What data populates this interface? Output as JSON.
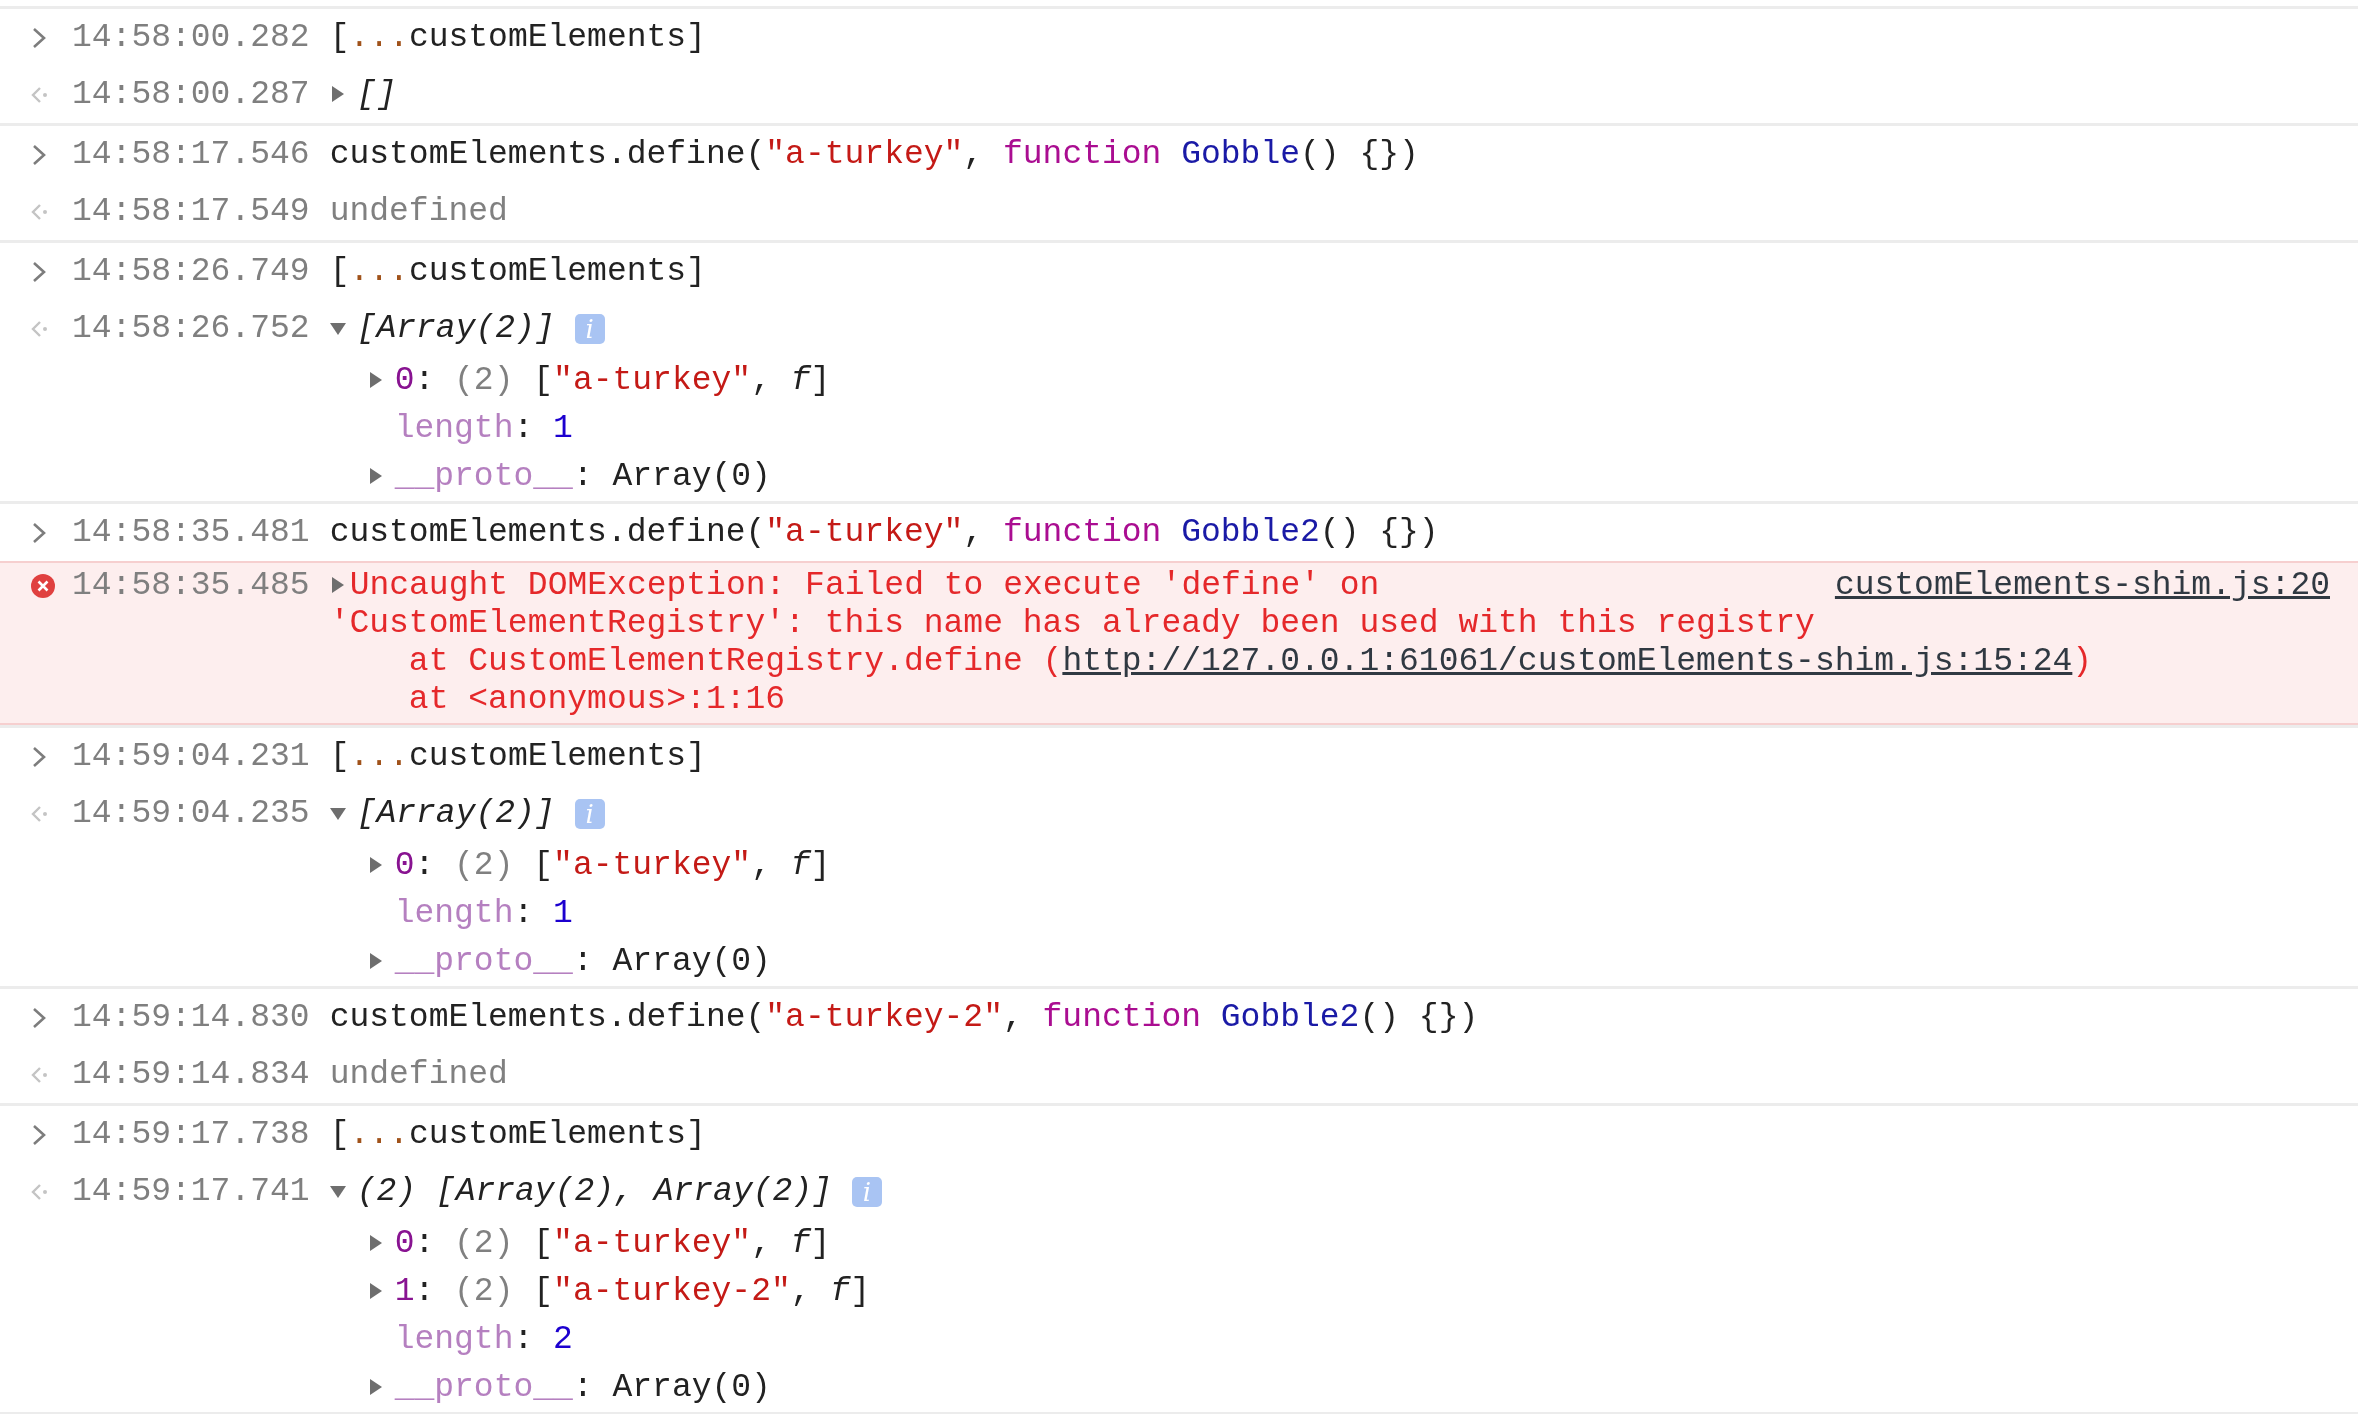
{
  "entries": [
    {
      "messages": [
        {
          "kind": "input",
          "time": "14:58:00.282",
          "tokens": [
            {
              "kind": "plain",
              "text": "["
            },
            {
              "kind": "spread",
              "text": "..."
            },
            {
              "kind": "plain",
              "text": "customElements]"
            }
          ]
        },
        {
          "kind": "output",
          "time": "14:58:00.287",
          "expanded": false,
          "tokens": [
            {
              "kind": "italic",
              "text": "[]"
            }
          ]
        }
      ]
    },
    {
      "messages": [
        {
          "kind": "input",
          "time": "14:58:17.546",
          "tokens": [
            {
              "kind": "plain",
              "text": "customElements.define("
            },
            {
              "kind": "string",
              "text": "\"a-turkey\""
            },
            {
              "kind": "plain",
              "text": ", "
            },
            {
              "kind": "keyword",
              "text": "function"
            },
            {
              "kind": "funcname",
              "text": " Gobble"
            },
            {
              "kind": "plain",
              "text": "() {})"
            }
          ]
        },
        {
          "kind": "output",
          "time": "14:58:17.549",
          "tokens": [
            {
              "kind": "muted",
              "text": "undefined"
            }
          ]
        }
      ]
    },
    {
      "messages": [
        {
          "kind": "input",
          "time": "14:58:26.749",
          "tokens": [
            {
              "kind": "plain",
              "text": "["
            },
            {
              "kind": "spread",
              "text": "..."
            },
            {
              "kind": "plain",
              "text": "customElements]"
            }
          ]
        },
        {
          "kind": "output",
          "time": "14:58:26.752",
          "expanded": true,
          "badge": "i",
          "tokens": [
            {
              "kind": "italic",
              "text": "[Array(2)]"
            }
          ],
          "children": [
            {
              "expanded": false,
              "tokens": [
                {
                  "kind": "index",
                  "text": "0"
                },
                {
                  "kind": "plain",
                  "text": ": "
                },
                {
                  "kind": "muted",
                  "text": "(2)"
                },
                {
                  "kind": "plain",
                  "text": " ["
                },
                {
                  "kind": "string",
                  "text": "\"a-turkey\""
                },
                {
                  "kind": "plain",
                  "text": ", "
                },
                {
                  "kind": "italic",
                  "text": "f"
                },
                {
                  "kind": "plain",
                  "text": "]"
                }
              ]
            },
            {
              "tokens": [
                {
                  "kind": "nonenum",
                  "text": "length"
                },
                {
                  "kind": "plain",
                  "text": ": "
                },
                {
                  "kind": "number",
                  "text": "1"
                }
              ]
            },
            {
              "expanded": false,
              "tokens": [
                {
                  "kind": "nonenum",
                  "text": "__proto__"
                },
                {
                  "kind": "plain",
                  "text": ": Array(0)"
                }
              ]
            }
          ]
        }
      ]
    },
    {
      "messages": [
        {
          "kind": "input",
          "time": "14:58:35.481",
          "tokens": [
            {
              "kind": "plain",
              "text": "customElements.define("
            },
            {
              "kind": "string",
              "text": "\"a-turkey\""
            },
            {
              "kind": "plain",
              "text": ", "
            },
            {
              "kind": "keyword",
              "text": "function"
            },
            {
              "kind": "funcname",
              "text": " Gobble2"
            },
            {
              "kind": "plain",
              "text": "() {})"
            }
          ]
        },
        {
          "kind": "error",
          "time": "14:58:35.485",
          "expanded": false,
          "source": "customElements-shim.js:20",
          "lines": [
            [
              {
                "kind": "plain",
                "text": "Uncaught DOMException: Failed to execute 'define' on"
              }
            ],
            [
              {
                "kind": "plain",
                "text": "'CustomElementRegistry': this name has already been used with this registry"
              }
            ],
            [
              {
                "kind": "plain",
                "text": "    at CustomElementRegistry.define ("
              },
              {
                "kind": "link",
                "text": "http://127.0.0.1:61061/customElements-shim.js:15:24"
              },
              {
                "kind": "plain",
                "text": ")"
              }
            ],
            [
              {
                "kind": "plain",
                "text": "    at <anonymous>:1:16"
              }
            ]
          ]
        }
      ]
    },
    {
      "messages": [
        {
          "kind": "input",
          "time": "14:59:04.231",
          "tokens": [
            {
              "kind": "plain",
              "text": "["
            },
            {
              "kind": "spread",
              "text": "..."
            },
            {
              "kind": "plain",
              "text": "customElements]"
            }
          ]
        },
        {
          "kind": "output",
          "time": "14:59:04.235",
          "expanded": true,
          "badge": "i",
          "tokens": [
            {
              "kind": "italic",
              "text": "[Array(2)]"
            }
          ],
          "children": [
            {
              "expanded": false,
              "tokens": [
                {
                  "kind": "index",
                  "text": "0"
                },
                {
                  "kind": "plain",
                  "text": ": "
                },
                {
                  "kind": "muted",
                  "text": "(2)"
                },
                {
                  "kind": "plain",
                  "text": " ["
                },
                {
                  "kind": "string",
                  "text": "\"a-turkey\""
                },
                {
                  "kind": "plain",
                  "text": ", "
                },
                {
                  "kind": "italic",
                  "text": "f"
                },
                {
                  "kind": "plain",
                  "text": "]"
                }
              ]
            },
            {
              "tokens": [
                {
                  "kind": "nonenum",
                  "text": "length"
                },
                {
                  "kind": "plain",
                  "text": ": "
                },
                {
                  "kind": "number",
                  "text": "1"
                }
              ]
            },
            {
              "expanded": false,
              "tokens": [
                {
                  "kind": "nonenum",
                  "text": "__proto__"
                },
                {
                  "kind": "plain",
                  "text": ": Array(0)"
                }
              ]
            }
          ]
        }
      ]
    },
    {
      "messages": [
        {
          "kind": "input",
          "time": "14:59:14.830",
          "tokens": [
            {
              "kind": "plain",
              "text": "customElements.define("
            },
            {
              "kind": "string",
              "text": "\"a-turkey-2\""
            },
            {
              "kind": "plain",
              "text": ", "
            },
            {
              "kind": "keyword",
              "text": "function"
            },
            {
              "kind": "funcname",
              "text": " Gobble2"
            },
            {
              "kind": "plain",
              "text": "() {})"
            }
          ]
        },
        {
          "kind": "output",
          "time": "14:59:14.834",
          "tokens": [
            {
              "kind": "muted",
              "text": "undefined"
            }
          ]
        }
      ]
    },
    {
      "messages": [
        {
          "kind": "input",
          "time": "14:59:17.738",
          "tokens": [
            {
              "kind": "plain",
              "text": "["
            },
            {
              "kind": "spread",
              "text": "..."
            },
            {
              "kind": "plain",
              "text": "customElements]"
            }
          ]
        },
        {
          "kind": "output",
          "time": "14:59:17.741",
          "expanded": true,
          "badge": "i",
          "tokens": [
            {
              "kind": "italic",
              "text": "(2) [Array(2), Array(2)]"
            }
          ],
          "children": [
            {
              "expanded": false,
              "tokens": [
                {
                  "kind": "index",
                  "text": "0"
                },
                {
                  "kind": "plain",
                  "text": ": "
                },
                {
                  "kind": "muted",
                  "text": "(2)"
                },
                {
                  "kind": "plain",
                  "text": " ["
                },
                {
                  "kind": "string",
                  "text": "\"a-turkey\""
                },
                {
                  "kind": "plain",
                  "text": ", "
                },
                {
                  "kind": "italic",
                  "text": "f"
                },
                {
                  "kind": "plain",
                  "text": "]"
                }
              ]
            },
            {
              "expanded": false,
              "tokens": [
                {
                  "kind": "index",
                  "text": "1"
                },
                {
                  "kind": "plain",
                  "text": ": "
                },
                {
                  "kind": "muted",
                  "text": "(2)"
                },
                {
                  "kind": "plain",
                  "text": " ["
                },
                {
                  "kind": "string",
                  "text": "\"a-turkey-2\""
                },
                {
                  "kind": "plain",
                  "text": ", "
                },
                {
                  "kind": "italic",
                  "text": "f"
                },
                {
                  "kind": "plain",
                  "text": "]"
                }
              ]
            },
            {
              "tokens": [
                {
                  "kind": "nonenum",
                  "text": "length"
                },
                {
                  "kind": "plain",
                  "text": ": "
                },
                {
                  "kind": "number",
                  "text": "2"
                }
              ]
            },
            {
              "expanded": false,
              "tokens": [
                {
                  "kind": "nonenum",
                  "text": "__proto__"
                },
                {
                  "kind": "plain",
                  "text": ": Array(0)"
                }
              ]
            }
          ]
        }
      ]
    }
  ]
}
